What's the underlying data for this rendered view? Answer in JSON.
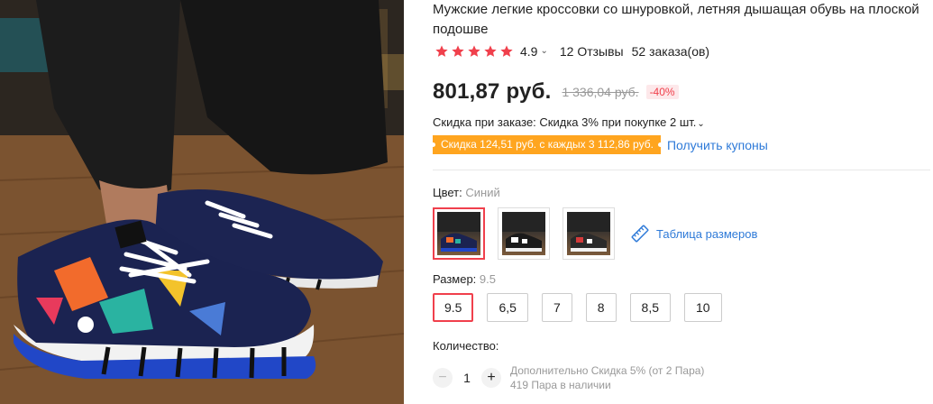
{
  "product": {
    "title": "Мужские легкие кроссовки со шнуровкой, летняя дышащая обувь на плоской подошве",
    "rating": "4.9",
    "reviews": "12 Отзывы",
    "orders": "52 заказа(ов)",
    "star_color": "#f0404c"
  },
  "price": {
    "current": "801,87 руб.",
    "old": "1 336,04 руб.",
    "discount": "-40%"
  },
  "store_discount": {
    "text": "Скидка при заказе: Скидка 3% при покупке 2 шт."
  },
  "coupon": {
    "tag": "Скидка 124,51 руб. с каждых 3 112,86 руб.",
    "link": "Получить купоны",
    "tag_color": "#ffa51f"
  },
  "color": {
    "label": "Цвет:",
    "selected": "Синий",
    "size_table": "Таблица размеров"
  },
  "size": {
    "label": "Размер:",
    "selected": "9.5",
    "options": [
      "9.5",
      "6,5",
      "7",
      "8",
      "8,5",
      "10"
    ]
  },
  "quantity": {
    "label": "Количество:",
    "value": "1",
    "minus": "−",
    "plus": "+",
    "note1": "Дополнительно Скидка 5% (от 2 Пара)",
    "note2": "419 Пара в наличии"
  },
  "icons": [
    "star-icon",
    "chevron-down-icon",
    "ruler-icon",
    "minus-icon",
    "plus-icon"
  ]
}
